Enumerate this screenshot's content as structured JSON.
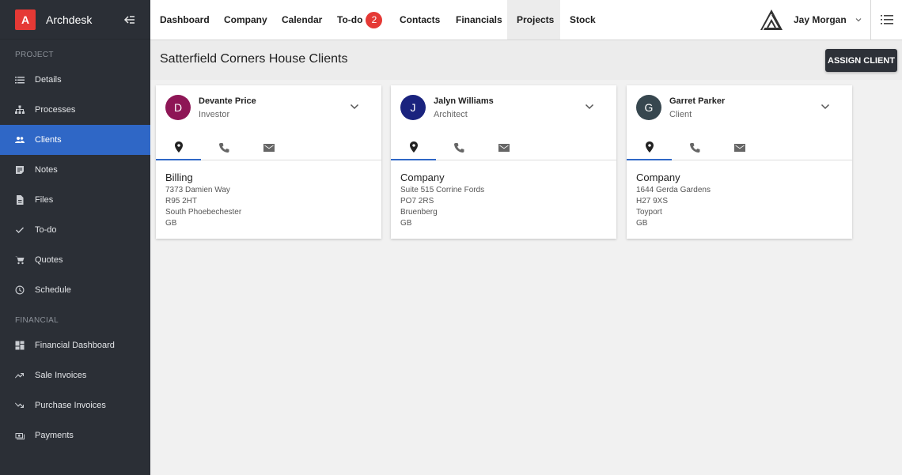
{
  "app": {
    "brand_letter": "A",
    "brand_name": "Archdesk"
  },
  "sidebar": {
    "sections": [
      {
        "label": "PROJECT"
      },
      {
        "label": "FINANCIAL"
      }
    ],
    "project_items": [
      {
        "label": "Details",
        "icon": "list-icon"
      },
      {
        "label": "Processes",
        "icon": "hierarchy-icon"
      },
      {
        "label": "Clients",
        "icon": "people-icon",
        "active": true
      },
      {
        "label": "Notes",
        "icon": "note-icon"
      },
      {
        "label": "Files",
        "icon": "file-icon"
      },
      {
        "label": "To-do",
        "icon": "check-icon"
      },
      {
        "label": "Quotes",
        "icon": "cart-icon"
      },
      {
        "label": "Schedule",
        "icon": "clock-icon"
      }
    ],
    "financial_items": [
      {
        "label": "Financial Dashboard",
        "icon": "dashboard-icon"
      },
      {
        "label": "Sale Invoices",
        "icon": "trending-up-icon"
      },
      {
        "label": "Purchase Invoices",
        "icon": "trending-down-icon"
      },
      {
        "label": "Payments",
        "icon": "payments-icon"
      }
    ]
  },
  "topnav": {
    "tabs": [
      {
        "label": "Dashboard"
      },
      {
        "label": "Company"
      },
      {
        "label": "Calendar"
      },
      {
        "label": "To-do",
        "badge": "2"
      },
      {
        "label": "Contacts"
      },
      {
        "label": "Financials"
      },
      {
        "label": "Projects",
        "active": true
      },
      {
        "label": "Stock"
      }
    ],
    "user_name": "Jay Morgan"
  },
  "page": {
    "title": "Satterfield Corners House Clients",
    "assign_button": "ASSIGN CLIENT"
  },
  "clients": [
    {
      "initial": "D",
      "avatar_color": "#8e1656",
      "name": "Devante Price",
      "role": "Investor",
      "address_title": "Billing",
      "address_lines": [
        "7373 Damien Way",
        "R95 2HT",
        "South Phoebechester",
        "GB"
      ]
    },
    {
      "initial": "J",
      "avatar_color": "#1a237e",
      "name": "Jalyn Williams",
      "role": "Architect",
      "address_title": "Company",
      "address_lines": [
        "Suite 515 Corrine Fords",
        "PO7 2RS",
        "Bruenberg",
        "GB"
      ]
    },
    {
      "initial": "G",
      "avatar_color": "#37474f",
      "name": "Garret Parker",
      "role": "Client",
      "address_title": "Company",
      "address_lines": [
        "1644 Gerda Gardens",
        "H27 9XS",
        "Toyport",
        "GB"
      ]
    }
  ],
  "colors": {
    "accent": "#2f67c6",
    "sidebar_bg": "#2b2f36",
    "badge": "#e53935"
  }
}
